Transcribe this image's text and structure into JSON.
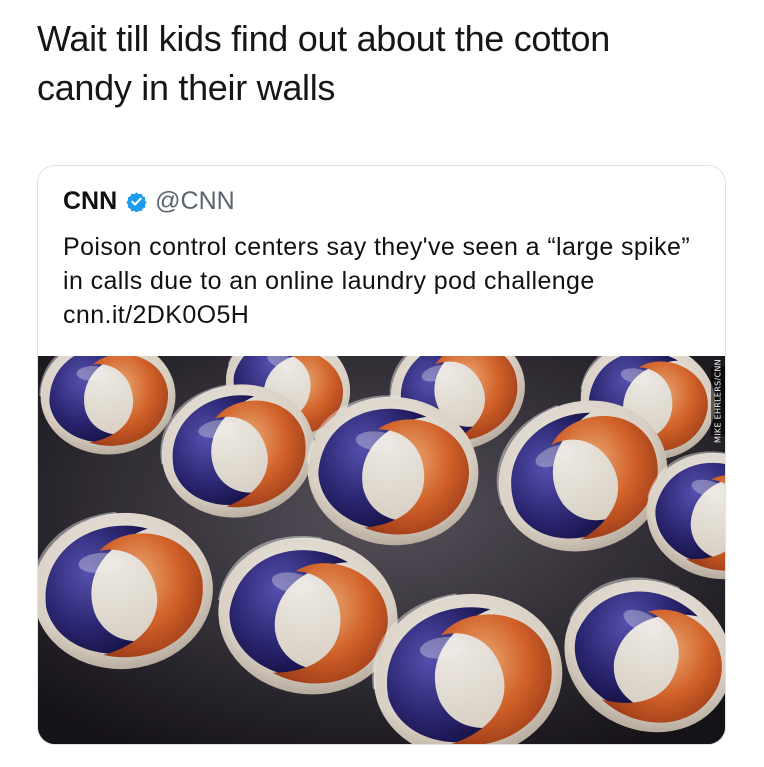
{
  "caption": {
    "line1": "Wait till kids find out about the cotton",
    "line2": "candy in their walls"
  },
  "tweet": {
    "author_name": "CNN",
    "verified_icon": "verified-badge-icon",
    "handle": "@CNN",
    "text": "Poison control centers say they've seen a “large spike” in calls due to an online laundry pod challenge cnn.it/2DK0O5H",
    "photo": {
      "subject": "laundry-pods-photo",
      "credit": "MIKE EHRLERS/CNN",
      "colors": {
        "purple": "#2f2a7a",
        "orange": "#e0692d",
        "cream": "#ece6dc",
        "shadow": "#1f1b22"
      }
    }
  }
}
